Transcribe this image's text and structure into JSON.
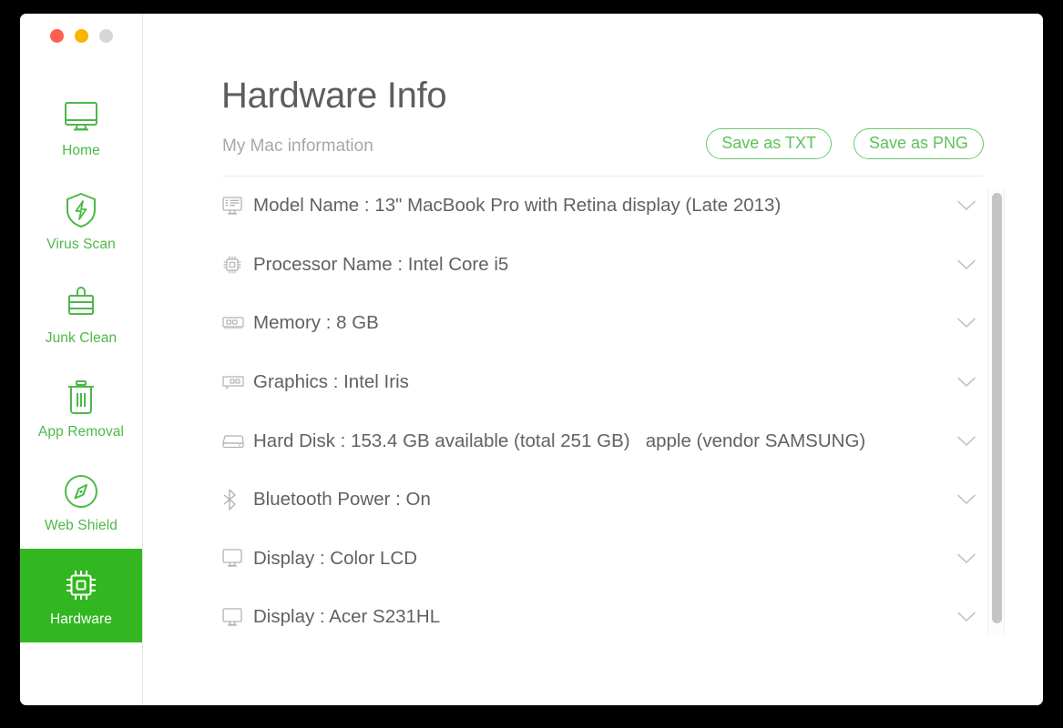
{
  "window": {
    "traffic_lights": [
      {
        "name": "close",
        "color": "#ff5f52"
      },
      {
        "name": "minimize",
        "color": "#f7b500"
      },
      {
        "name": "maximize",
        "color": "#d6d6d6"
      }
    ]
  },
  "theme": {
    "accent_green": "#4cb949",
    "active_green": "#32b721",
    "text_dark": "#5a5f5e",
    "text_muted": "#a6a9a8",
    "icon_gray": "#b0b3b2"
  },
  "sidebar": {
    "items": [
      {
        "label": "Home",
        "icon": "monitor-icon",
        "active": false
      },
      {
        "label": "Virus Scan",
        "icon": "shield-bolt-icon",
        "active": false
      },
      {
        "label": "Junk Clean",
        "icon": "brush-icon",
        "active": false
      },
      {
        "label": "App Removal",
        "icon": "trash-icon",
        "active": false
      },
      {
        "label": "Web Shield",
        "icon": "compass-icon",
        "active": false
      },
      {
        "label": "Hardware",
        "icon": "cpu-icon",
        "active": true
      }
    ]
  },
  "header": {
    "title": "Hardware Info",
    "subtitle": "My Mac information",
    "save_txt_label": "Save as TXT",
    "save_png_label": "Save as PNG"
  },
  "info_list": {
    "rows": [
      {
        "icon": "monitor-text-icon",
        "text": "Model Name : 13\" MacBook Pro with Retina display (Late 2013)"
      },
      {
        "icon": "cpu-icon",
        "text": "Processor Name : Intel Core i5"
      },
      {
        "icon": "memory-icon",
        "text": "Memory : 8 GB"
      },
      {
        "icon": "graphics-card-icon",
        "text": "Graphics : Intel Iris"
      },
      {
        "icon": "hard-disk-icon",
        "text": "Hard Disk : 153.4 GB available (total 251 GB)   apple (vendor SAMSUNG)"
      },
      {
        "icon": "bluetooth-icon",
        "text": "Bluetooth Power : On"
      },
      {
        "icon": "display-icon",
        "text": "Display : Color LCD"
      },
      {
        "icon": "display-icon",
        "text": "Display : Acer S231HL"
      }
    ]
  },
  "scrollbar": {
    "orientation": "vertical",
    "thumb_position": "top"
  }
}
